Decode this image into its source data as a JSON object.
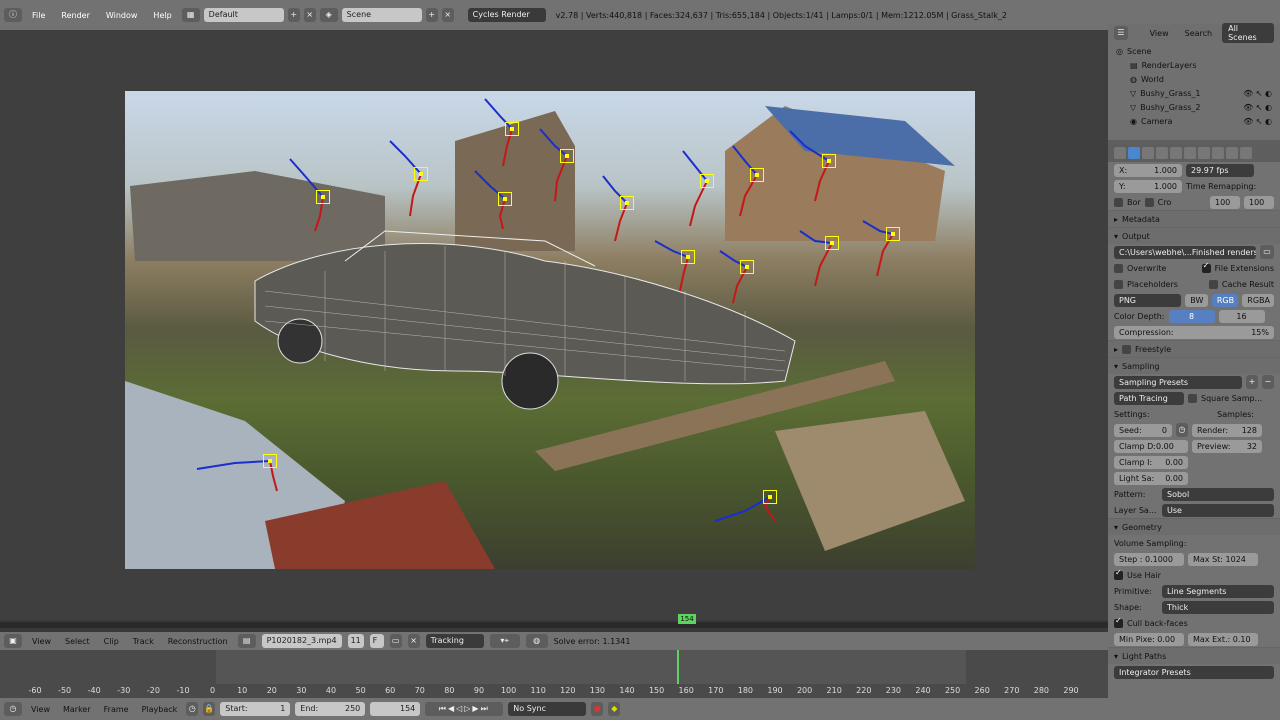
{
  "topbar": {
    "menus": [
      "File",
      "Render",
      "Window",
      "Help"
    ],
    "layout": "Default",
    "scene": "Scene",
    "engine": "Cycles Render",
    "stats": "v2.78 | Verts:440,818 | Faces:324,637 | Tris:655,184 | Objects:1/41 | Lamps:0/1 | Mem:1212.05M | Grass_Stalk_2"
  },
  "outliner": {
    "tabs": [
      "View",
      "Search",
      "All Scenes"
    ],
    "items": [
      "Scene",
      "RenderLayers",
      "World",
      "Bushy_Grass_1",
      "Bushy_Grass_2",
      "Camera"
    ]
  },
  "props": {
    "res_x": "X:",
    "res_x_val": "1.000",
    "res_y": "Y:",
    "res_y_val": "1.000",
    "fps": "29.97 fps",
    "time_remap": "Time Remapping:",
    "remap_a": "100",
    "remap_b": "100",
    "bor": "Bor",
    "cro": "Cro",
    "metadata": "Metadata",
    "output": "Output",
    "path": "C:\\Users\\webhe\\...Finished renders\\",
    "overwrite": "Overwrite",
    "file_ext": "File Extensions",
    "placeholders": "Placeholders",
    "cache": "Cache Result",
    "format": "PNG",
    "bw": "BW",
    "rgb": "RGB",
    "rgba": "RGBA",
    "color_depth": "Color Depth:",
    "depth_8": "8",
    "depth_16": "16",
    "compression": "Compression:",
    "compression_val": "15%",
    "freestyle": "Freestyle",
    "sampling": "Sampling",
    "sampling_presets": "Sampling Presets",
    "path_tracing": "Path Tracing",
    "square_samples": "Square Samp...",
    "settings": "Settings:",
    "samples": "Samples:",
    "seed": "Seed:",
    "seed_val": "0",
    "render": "Render:",
    "render_val": "128",
    "clamp_d": "Clamp D:0.00",
    "preview": "Preview:",
    "preview_val": "32",
    "clamp_i": "Clamp I:",
    "clamp_i_val": "0.00",
    "light_sa": "Light Sa:",
    "light_sa_val": "0.00",
    "pattern": "Pattern:",
    "pattern_val": "Sobol",
    "layer_sa": "Layer Sa...",
    "layer_sa_val": "Use",
    "geometry": "Geometry",
    "volume_sampling": "Volume Sampling:",
    "step": "Step : 0.1000",
    "max_st": "Max St: 1024",
    "use_hair": "Use Hair",
    "primitive": "Primitive:",
    "primitive_val": "Line Segments",
    "shape": "Shape:",
    "shape_val": "Thick",
    "cull": "Cull back-faces",
    "min_pixel": "Min Pixe: 0.00",
    "max_ext": "Max Ext.: 0.10",
    "light_paths": "Light Paths",
    "integrator": "Integrator Presets"
  },
  "clip": {
    "menus": [
      "View",
      "Select",
      "Clip",
      "Track",
      "Reconstruction"
    ],
    "file": "P1020182_3.mp4",
    "users": "11",
    "f": "F",
    "mode": "Tracking",
    "solve_error": "Solve error: 1.1341",
    "current_frame_marker": "154"
  },
  "timeline": {
    "ticks": [
      "-60",
      "-50",
      "-40",
      "-30",
      "-20",
      "-10",
      "0",
      "10",
      "20",
      "30",
      "40",
      "50",
      "60",
      "70",
      "80",
      "90",
      "100",
      "110",
      "120",
      "130",
      "140",
      "150",
      "160",
      "170",
      "180",
      "190",
      "200",
      "210",
      "220",
      "230",
      "240",
      "250",
      "260",
      "270",
      "280",
      "290"
    ]
  },
  "bottom": {
    "menus": [
      "View",
      "Marker",
      "Frame",
      "Playback"
    ],
    "start": "Start:",
    "start_val": "1",
    "end": "End:",
    "end_val": "250",
    "current": "154",
    "sync": "No Sync"
  }
}
